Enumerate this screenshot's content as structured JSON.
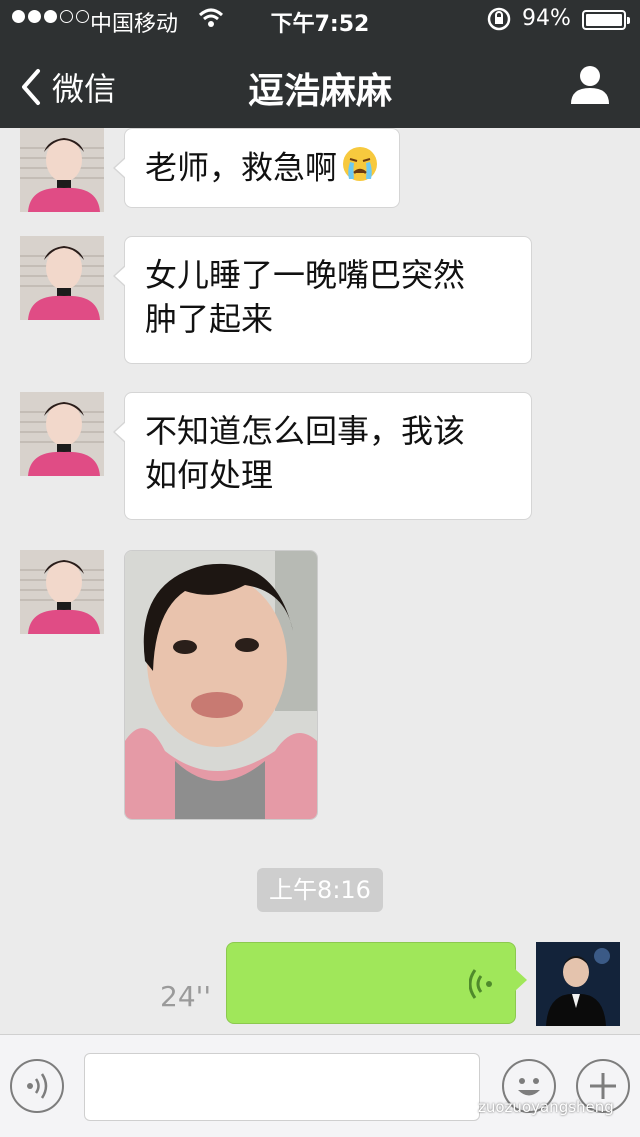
{
  "status_bar": {
    "carrier": "中国移动",
    "time": "下午7:52",
    "battery_percent": "94%",
    "battery_level": 0.94,
    "signal_bars_filled": 3,
    "signal_bars_total": 5
  },
  "nav": {
    "back_label": "微信",
    "title": "逗浩麻麻",
    "profile_icon": "person-icon"
  },
  "messages": [
    {
      "sender": "contact",
      "text": "老师，救急啊",
      "emoji": "crying-face"
    },
    {
      "sender": "contact",
      "text_line1": "女儿睡了一晚嘴巴突然",
      "text_line2": "肿了起来"
    },
    {
      "sender": "contact",
      "text_line1": "不知道怎么回事，我该",
      "text_line2": "如何处理"
    },
    {
      "sender": "contact",
      "type": "photo"
    }
  ],
  "timestamp": "上午8:16",
  "voice_message": {
    "sender": "me",
    "duration": "24''"
  },
  "input_bar": {
    "voice_icon": "voice-icon",
    "emoji_icon": "emoji-icon",
    "plus_icon": "plus-icon"
  },
  "watermark": "zuozuoyangsheng",
  "colors": {
    "nav_bg": "#2e3132",
    "chat_bg": "#ebebeb",
    "my_bubble": "#a0e75a"
  }
}
